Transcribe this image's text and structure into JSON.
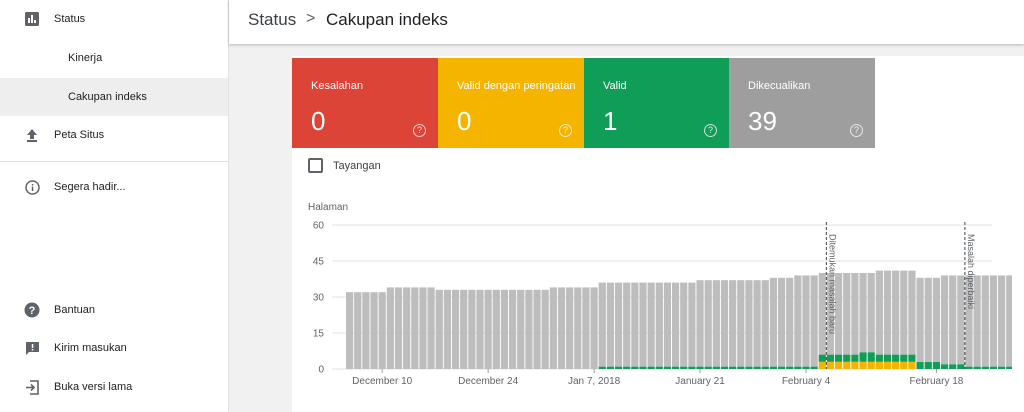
{
  "sidebar": {
    "items": [
      {
        "label": "Status",
        "icon": "bar-chart-icon"
      },
      {
        "label": "Kinerja"
      },
      {
        "label": "Cakupan indeks"
      },
      {
        "label": "Peta Situs",
        "icon": "upload-icon"
      },
      {
        "label": "Segera hadir...",
        "icon": "info-icon"
      },
      {
        "label": "Bantuan",
        "icon": "help-icon"
      },
      {
        "label": "Kirim masukan",
        "icon": "feedback-icon"
      },
      {
        "label": "Buka versi lama",
        "icon": "exit-icon"
      }
    ]
  },
  "header": {
    "parent": "Status",
    "separator": ">",
    "current": "Cakupan indeks"
  },
  "tiles": [
    {
      "label": "Kesalahan",
      "value": "0",
      "color": "#db4437"
    },
    {
      "label": "Valid dengan peringatan",
      "value": "0",
      "color": "#f4b400"
    },
    {
      "label": "Valid",
      "value": "1",
      "color": "#0f9d58"
    },
    {
      "label": "Dikecualikan",
      "value": "39",
      "color": "#9e9e9e"
    }
  ],
  "help_glyph": "?",
  "impressions_checkbox": {
    "label": "Tayangan",
    "checked": false
  },
  "chart_data": {
    "type": "bar",
    "stacked": true,
    "ylabel": "Halaman",
    "ylim": [
      0,
      60
    ],
    "yticks": [
      "60",
      "45",
      "30",
      "15",
      "0"
    ],
    "xticks": [
      "December 10",
      "December 24",
      "Jan 7, 2018",
      "January 21",
      "February 4",
      "February 18"
    ],
    "series": [
      {
        "color": "#db4437",
        "values": [
          0,
          0,
          0,
          0,
          0,
          0,
          0,
          0,
          0,
          0,
          0,
          0,
          0,
          0,
          0,
          0,
          0,
          0,
          0,
          0,
          0,
          0,
          0,
          0,
          0,
          0,
          0,
          0,
          0,
          0,
          0,
          0,
          0,
          0,
          0,
          0,
          0,
          0,
          0,
          0,
          0,
          0,
          0,
          0,
          0,
          0,
          0,
          0,
          0,
          0,
          0,
          0,
          0,
          0,
          0,
          0,
          0,
          0,
          0,
          0,
          0,
          0,
          0,
          0,
          0,
          0,
          0,
          0,
          0,
          0,
          0,
          0,
          0,
          0,
          0,
          0,
          0
        ]
      },
      {
        "color": "#f4b400",
        "values": [
          0,
          0,
          0,
          0,
          0,
          0,
          0,
          0,
          0,
          0,
          0,
          0,
          0,
          0,
          0,
          0,
          0,
          0,
          0,
          0,
          0,
          0,
          0,
          0,
          0,
          0,
          0,
          0,
          0,
          0,
          0,
          0,
          0,
          0,
          0,
          0,
          0,
          0,
          0,
          0,
          0,
          0,
          0,
          0,
          0,
          0,
          0,
          0,
          0,
          0,
          0,
          0,
          0,
          0,
          0,
          0,
          0,
          0,
          3,
          3,
          3,
          3,
          3,
          3,
          3,
          3,
          3,
          3,
          3,
          3,
          0,
          0,
          0,
          0,
          0,
          0,
          0
        ]
      },
      {
        "color": "#0f9d58",
        "values": [
          0,
          0,
          0,
          0,
          0,
          0,
          0,
          0,
          0,
          0,
          0,
          0,
          0,
          0,
          0,
          0,
          0,
          0,
          0,
          0,
          0,
          0,
          0,
          0,
          0,
          0,
          0,
          0,
          0,
          0,
          0,
          1,
          1,
          1,
          1,
          1,
          1,
          1,
          1,
          1,
          1,
          1,
          1,
          1,
          1,
          1,
          1,
          1,
          1,
          1,
          1,
          1,
          1,
          1,
          1,
          1,
          1,
          1,
          3,
          3,
          3,
          3,
          3,
          4,
          4,
          3,
          3,
          3,
          3,
          3,
          3,
          3,
          3,
          2,
          2,
          2,
          1,
          1,
          1,
          1,
          1,
          1,
          1
        ]
      },
      {
        "color": "#bdbdbd",
        "values": [
          32,
          32,
          32,
          32,
          32,
          34,
          34,
          34,
          34,
          34,
          34,
          33,
          33,
          33,
          33,
          33,
          33,
          33,
          33,
          33,
          33,
          33,
          33,
          33,
          33,
          34,
          34,
          34,
          34,
          34,
          34,
          35,
          35,
          35,
          35,
          35,
          35,
          35,
          35,
          35,
          35,
          35,
          35,
          36,
          36,
          36,
          36,
          36,
          36,
          36,
          36,
          36,
          37,
          37,
          37,
          38,
          38,
          38,
          34,
          34,
          34,
          34,
          34,
          33,
          33,
          35,
          35,
          35,
          35,
          35,
          35,
          35,
          35,
          37,
          37,
          37,
          38,
          38,
          38,
          38,
          38,
          38,
          38
        ]
      }
    ],
    "annotations": [
      {
        "label": "Ditemukan masalah baru",
        "index": 59
      },
      {
        "label": "Masalah diperbaiki",
        "index": 76
      }
    ],
    "grid": true
  }
}
